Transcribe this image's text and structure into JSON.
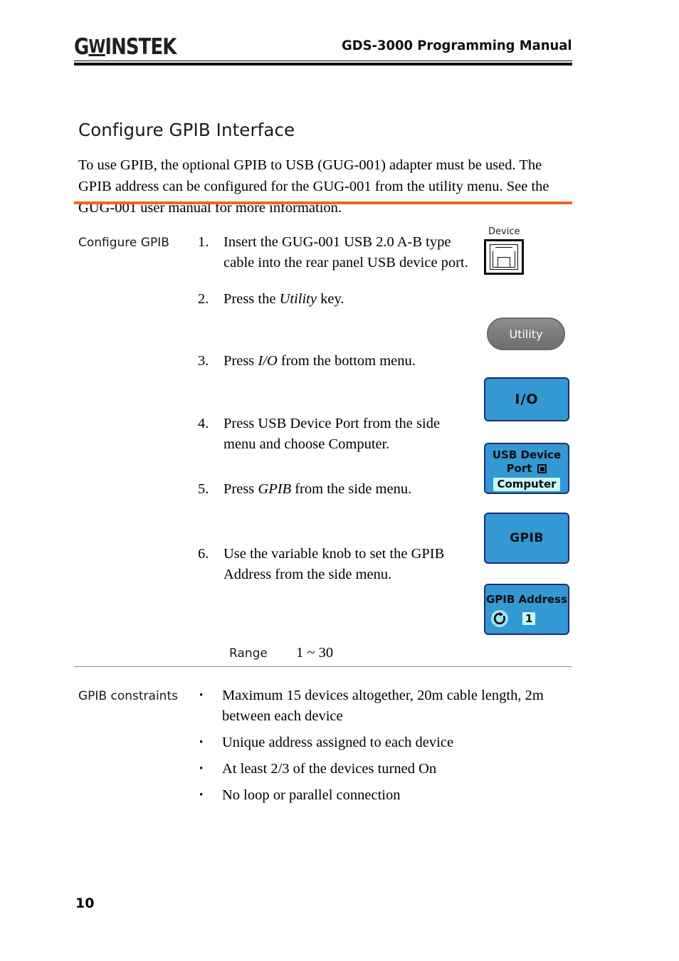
{
  "header": {
    "logo_main": "G",
    "logo_u": "W",
    "logo_rest": "INSTEK",
    "title": "GDS-3000 Programming Manual"
  },
  "section": {
    "heading": "Configure GPIB Interface",
    "intro": "To use GPIB, the optional GPIB to USB (GUG-001) adapter must be used. The GPIB address can be configured for the GUG-001 from the utility menu. See the GUG-001 user manual for more information."
  },
  "procedure": {
    "label": "Configure GPIB",
    "steps": [
      {
        "num": "1.",
        "pre": "Insert the GUG-001 USB 2.0 A-B type cable into the rear panel USB device port.",
        "em": "",
        "post": ""
      },
      {
        "num": "2.",
        "pre": "Press the ",
        "em": "Utility",
        "post": " key."
      },
      {
        "num": "3.",
        "pre": "Press ",
        "em": "I/O",
        "post": " from the bottom menu."
      },
      {
        "num": "4.",
        "pre": "Press USB Device Port from the side menu and choose Computer.",
        "em": "",
        "post": ""
      },
      {
        "num": "5.",
        "pre": "Press ",
        "em": "GPIB",
        "post": " from the side menu."
      },
      {
        "num": "6.",
        "pre": "Use the variable knob to set the GPIB Address from the side menu.",
        "em": "",
        "post": ""
      }
    ]
  },
  "figures": {
    "usb_caption": "Device",
    "utility_key": "Utility",
    "io_key": "I/O",
    "usb_port_line1": "USB Device",
    "usb_port_line2": "Port",
    "usb_port_value": "Computer",
    "gpib_key": "GPIB",
    "gpib_address_title": "GPIB Address",
    "gpib_address_value": "1"
  },
  "range": {
    "label": "Range",
    "value": "1 ~ 30"
  },
  "constraints": {
    "label": "GPIB constraints",
    "items": [
      "Maximum 15 devices altogether, 20m cable length, 2m between each device",
      "Unique address assigned to each device",
      "At least 2/3 of the devices turned On",
      "No loop or parallel connection"
    ],
    "bullet_glyph": "•"
  },
  "footer": {
    "page_number": "10"
  },
  "colors": {
    "accent_orange": "#f26522",
    "softkey_blue": "#3498d2",
    "softkey_border": "#1c2d7a",
    "highlight_cyan": "#c9f5f5",
    "hardkey_gray": "#7c7c7c"
  }
}
